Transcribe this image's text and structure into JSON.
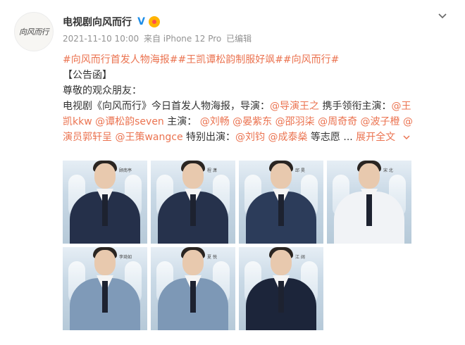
{
  "post": {
    "author": "电视剧向风而行",
    "avatar_text": "向风而行",
    "verified_icon": "verified-v-icon",
    "badge_icon": "level-badge-icon",
    "timestamp": "2021-11-10 10:00",
    "source": "来自 iPhone 12 Pro",
    "edited": "已编辑"
  },
  "content": {
    "hashtags": "#向风而行首发人物海报##王凯谭松韵制服好飒##向风而行#",
    "line2": "【公告函】",
    "line3": "尊敬的观众朋友：",
    "line4_a": "电视剧《向风而行》今日首发人物海报，导演：",
    "line4_link1": "@导演王之",
    "line4_b": " 携手领衔主演：",
    "line4_link2": "@王",
    "line5_link1": "凯kkw",
    "line5_sp1": " ",
    "line5_link2": "@谭松韵seven",
    "line5_a": " 主演： ",
    "line5_link3": "@刘畅",
    "line5_sp2": " ",
    "line5_link4": "@晏紫东",
    "line5_sp3": " ",
    "line5_link5": "@邵羽柒",
    "line5_sp4": " ",
    "line5_link6": "@周奇奇",
    "line5_sp5": " ",
    "line5_link7": "@波子橙",
    "line5_sp6": " ",
    "line5_link8": "@",
    "line6_link1": "演员郭轩呈",
    "line6_sp1": " ",
    "line6_link2": "@王策wangce",
    "line6_a": " 特别出演：",
    "line6_link3": "@刘钧",
    "line6_sp2": " ",
    "line6_link4": "@成泰燊",
    "line6_b": " 等志愿 ... ",
    "expand": "展开全文",
    "expand_icon": "chevron-down-icon"
  },
  "photos": [
    {
      "tag": "顾南亭",
      "uniform": "#25304a"
    },
    {
      "tag": "程 潇",
      "uniform": "#26324c"
    },
    {
      "tag": "邱 昊",
      "uniform": "#2c3c5a"
    },
    {
      "tag": "宋 北",
      "uniform": "#f1f3f6"
    },
    {
      "tag": "李琦如",
      "uniform": "#7f9ab8"
    },
    {
      "tag": "夏 悦",
      "uniform": "#7d98b6"
    },
    {
      "tag": "江 阔",
      "uniform": "#1c253a"
    }
  ],
  "colors": {
    "link": "#eb7350",
    "verified": "#1e8ee8",
    "meta": "#939393"
  }
}
